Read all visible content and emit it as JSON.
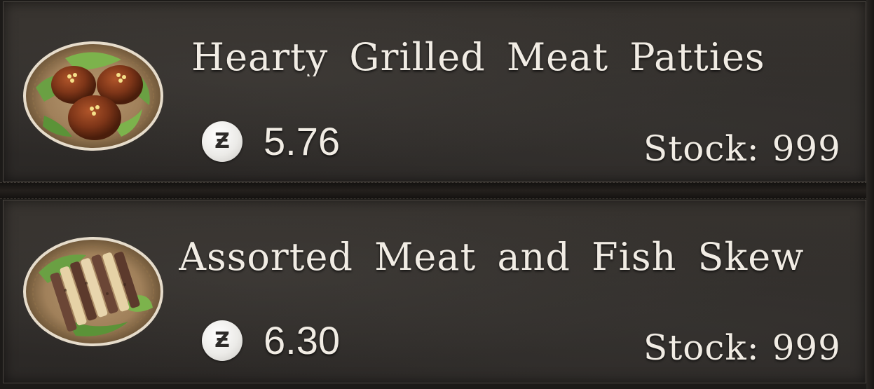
{
  "shop": {
    "items": [
      {
        "name": "Hearty Grilled Meat Patties",
        "price": "5.76",
        "stock_label": "Stock:",
        "stock_value": "999",
        "image_icon": "meat-patties-plate-icon"
      },
      {
        "name": "Assorted Meat and Fish Skew",
        "price": "6.30",
        "stock_label": "Stock:",
        "stock_value": "999",
        "image_icon": "meat-fish-skewers-plate-icon"
      }
    ],
    "currency_icon": "currency-coin-icon",
    "currency_symbol": "Ƶ"
  },
  "colors": {
    "panel": "#2f2c29",
    "text": "#f1ece4",
    "coin": "#ecebe8"
  }
}
